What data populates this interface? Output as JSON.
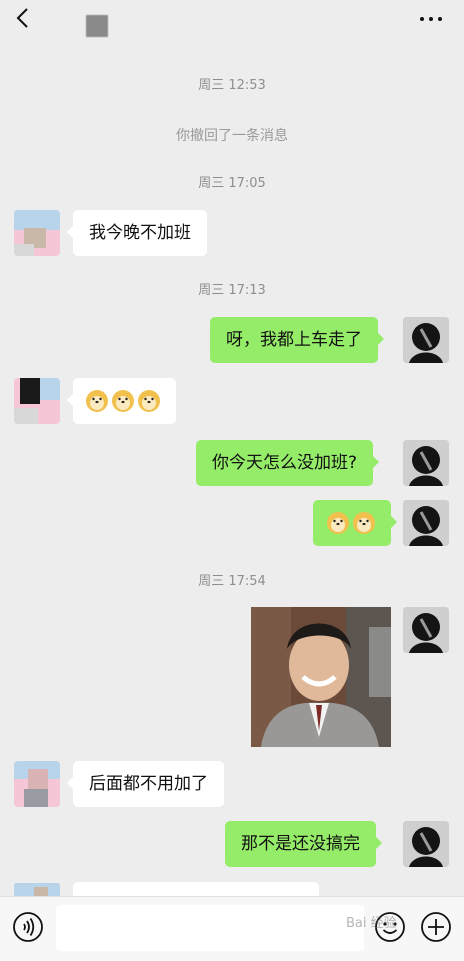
{
  "header": {
    "title_icon": "blurred-contact-name",
    "back_icon": "chevron-left-icon",
    "more_icon": "more-dots-icon"
  },
  "messages": {
    "t1": "周三 12:53",
    "recall": "你撤回了一条消息",
    "t2": "周三 17:05",
    "m1": "我今晚不加班",
    "t3": "周三 17:13",
    "m2": "呀，我都上车走了",
    "m4": "你今天怎么没加班?",
    "t4": "周三 17:54",
    "m7": "后面都不用加了",
    "m8": "那不是还没搞完"
  },
  "input": {
    "placeholder": ""
  },
  "watermark": "Bai 经验",
  "colors": {
    "out_bubble": "#95ec69",
    "in_bubble": "#ffffff",
    "background": "#ededed"
  }
}
